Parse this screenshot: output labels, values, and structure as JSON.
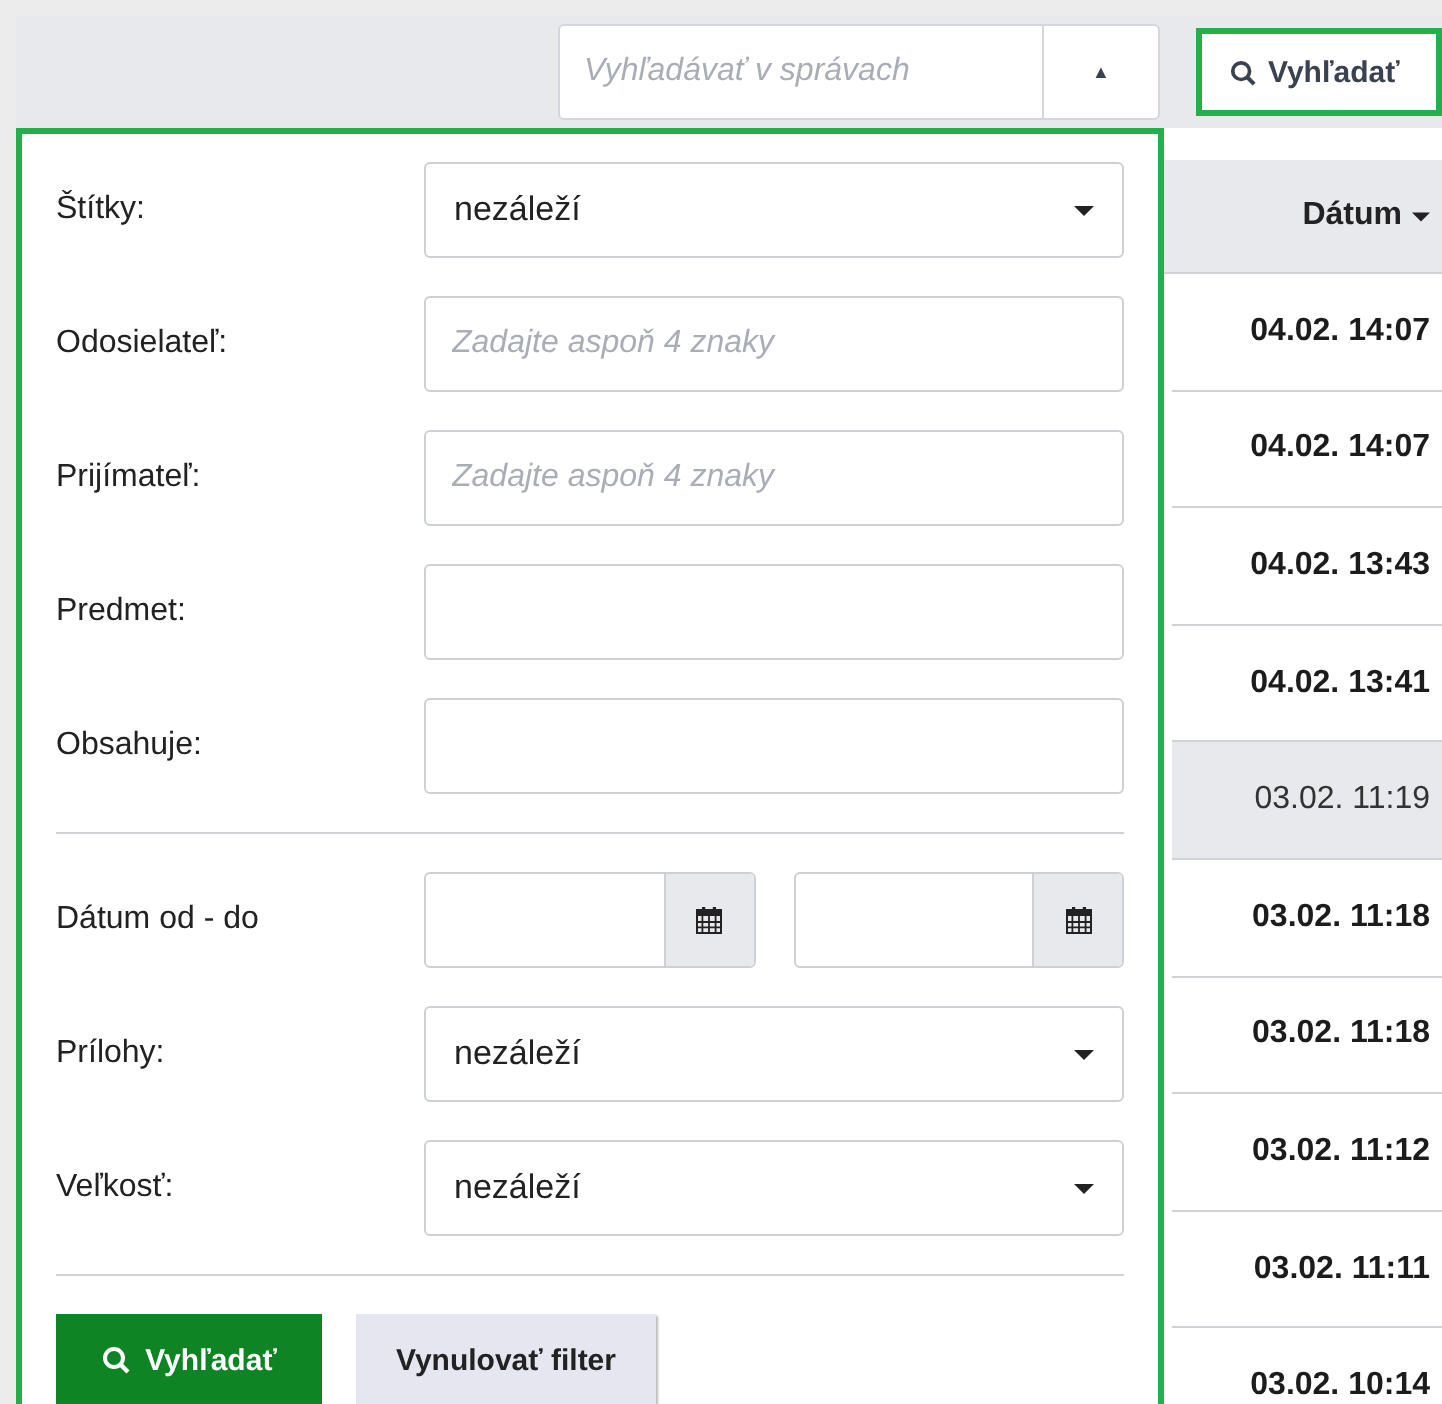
{
  "search": {
    "placeholder": "Vyhľadávať v správach",
    "toggle_icon": "▲"
  },
  "search_button": {
    "label": "Vyhľadať"
  },
  "filter": {
    "fields": [
      {
        "kind": "select",
        "label": "Štítky:",
        "value": "nezáleží"
      },
      {
        "kind": "text",
        "label": "Odosielateľ:",
        "placeholder": "Zadajte aspoň 4 znaky"
      },
      {
        "kind": "text",
        "label": "Prijímateľ:",
        "placeholder": "Zadajte aspoň 4 znaky"
      },
      {
        "kind": "text",
        "label": "Predmet:"
      },
      {
        "kind": "text",
        "label": "Obsahuje:"
      },
      {
        "kind": "divider"
      },
      {
        "kind": "date_range",
        "label": "Dátum od - do"
      },
      {
        "kind": "select",
        "label": "Prílohy:",
        "value": "nezáleží"
      },
      {
        "kind": "select",
        "label": "Veľkosť:",
        "value": "nezáleží"
      },
      {
        "kind": "divider"
      }
    ],
    "buttons": [
      {
        "label": "Vyhľadať",
        "kind": "primary"
      },
      {
        "label": "Vynulovať filter",
        "kind": "secondary"
      }
    ]
  },
  "table": {
    "column": "Dátum",
    "rows": [
      {
        "date": "04.02. 14:07",
        "unread": true
      },
      {
        "date": "04.02. 14:07",
        "unread": true
      },
      {
        "date": "04.02. 13:43",
        "unread": true
      },
      {
        "date": "04.02. 13:41",
        "unread": true
      },
      {
        "date": "03.02. 11:19",
        "unread": false
      },
      {
        "date": "03.02. 11:18",
        "unread": true
      },
      {
        "date": "03.02. 11:18",
        "unread": true
      },
      {
        "date": "03.02. 11:12",
        "unread": true
      },
      {
        "date": "03.02. 11:11",
        "unread": true
      },
      {
        "date": "03.02. 10:14",
        "unread": true
      }
    ]
  }
}
